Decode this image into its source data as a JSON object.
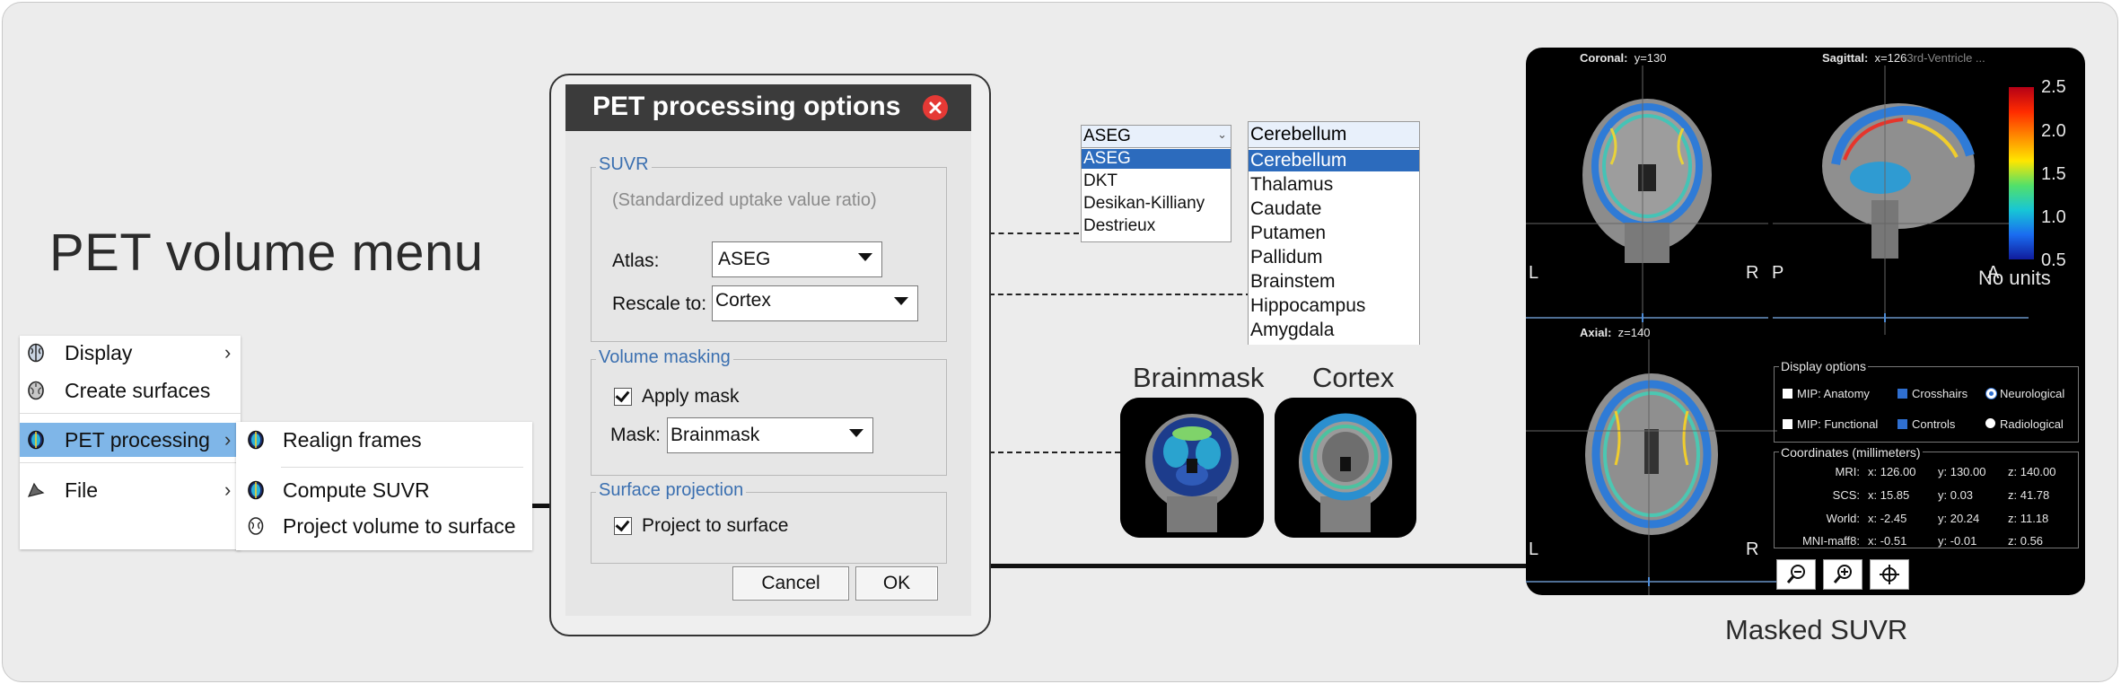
{
  "heading": "PET volume menu",
  "main_menu": {
    "items": [
      {
        "label": "Display",
        "has_submenu": true,
        "icon": "brain-icon"
      },
      {
        "label": "Create surfaces",
        "has_submenu": false,
        "icon": "brain-surface-icon"
      },
      {
        "label": "PET processing",
        "has_submenu": true,
        "icon": "pet-brain-icon",
        "selected": true
      },
      {
        "label": "File",
        "has_submenu": true,
        "icon": "file-icon"
      }
    ],
    "chevron": "›"
  },
  "sub_menu": {
    "items": [
      {
        "label": "Realign frames",
        "icon": "pet-brain-icon"
      },
      {
        "label": "Compute SUVR",
        "icon": "pet-brain-icon"
      },
      {
        "label": "Project volume to surface",
        "icon": "surface-brain-icon"
      }
    ]
  },
  "dialog": {
    "title": "PET processing options",
    "suvr_group": "SUVR",
    "suvr_desc": "(Standardized uptake value ratio)",
    "atlas_label": "Atlas:",
    "atlas_value": "ASEG",
    "rescale_label": "Rescale to:",
    "rescale_value": "Cortex",
    "masking_group": "Volume masking",
    "apply_mask_label": "Apply mask",
    "apply_mask_checked": true,
    "mask_label": "Mask:",
    "mask_value": "Brainmask",
    "surface_group": "Surface projection",
    "project_label": "Project to surface",
    "project_checked": true,
    "cancel": "Cancel",
    "ok": "OK"
  },
  "atlas_list": {
    "header": "ASEG",
    "options": [
      "ASEG",
      "DKT",
      "Desikan-Killiany",
      "Destrieux"
    ],
    "selected": 0
  },
  "region_list": {
    "header": "Cerebellum",
    "options": [
      "Cerebellum",
      "Thalamus",
      "Caudate",
      "Putamen",
      "Pallidum",
      "Brainstem",
      "Hippocampus",
      "Amygdala"
    ],
    "selected": 0
  },
  "mask_previews": [
    {
      "label": "Brainmask"
    },
    {
      "label": "Cortex"
    }
  ],
  "viewer": {
    "coronal_label": "Coronal:",
    "coronal_value": "y=130",
    "sagittal_label": "Sagittal:",
    "sagittal_value": "x=126",
    "sagittal_region": "3rd-Ventricle ...",
    "axial_label": "Axial:",
    "axial_value": "z=140",
    "orient": {
      "left": "L",
      "right": "R",
      "posterior": "P",
      "anterior": "A"
    },
    "colorbar_ticks": [
      "2.5",
      "2.0",
      "1.5",
      "1.0",
      "0.5"
    ],
    "units": "No units",
    "display_options": {
      "title": "Display options",
      "items": [
        {
          "label": "MIP: Anatomy",
          "checked": false,
          "type": "checkbox"
        },
        {
          "label": "Crosshairs",
          "checked": true,
          "type": "checkbox"
        },
        {
          "label": "Neurological",
          "checked": true,
          "type": "radio"
        },
        {
          "label": "MIP: Functional",
          "checked": false,
          "type": "checkbox"
        },
        {
          "label": "Controls",
          "checked": true,
          "type": "checkbox"
        },
        {
          "label": "Radiological",
          "checked": false,
          "type": "radio"
        }
      ]
    },
    "coordinates": {
      "title": "Coordinates (millimeters)",
      "rows": [
        {
          "name": "MRI:",
          "x": "x: 126.00",
          "y": "y: 130.00",
          "z": "z: 140.00"
        },
        {
          "name": "SCS:",
          "x": "x: 15.85",
          "y": "y: 0.03",
          "z": "z: 41.78"
        },
        {
          "name": "World:",
          "x": "x: -2.45",
          "y": "y: 20.24",
          "z": "z: 11.18"
        },
        {
          "name": "MNI-maff8:",
          "x": "x: -0.51",
          "y": "y: -0.01",
          "z": "z: 0.56"
        }
      ]
    },
    "buttons": [
      "zoom-out-icon",
      "zoom-in-icon",
      "reset-view-icon"
    ]
  },
  "viewer_caption": "Masked SUVR",
  "colors": {
    "menu_selected": "#7fb6e8",
    "list_selected": "#2c6bbd",
    "group_label": "#3a6fb0",
    "dialog_title_bg": "#3b3b3b",
    "close_button": "#e53935"
  }
}
